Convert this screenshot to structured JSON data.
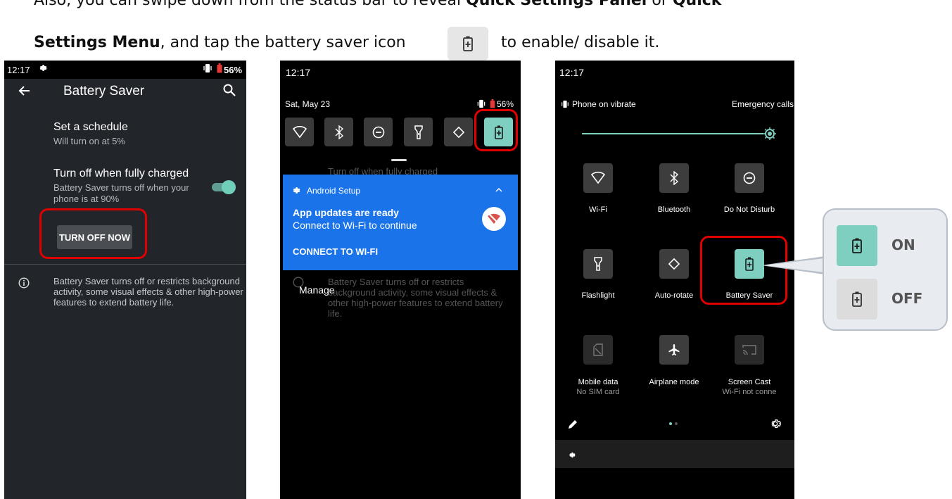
{
  "doc": {
    "line1_prefix": "Also, you can swipe down from the status bar to reveal ",
    "line1_bold1": "Quick Settings Panel",
    "line1_mid": " or ",
    "line1_bold2": "Quick",
    "line2_bold": "Settings Menu",
    "line2_mid": ", and tap the battery saver icon ",
    "line2_suffix": " to enable/ disable it."
  },
  "phone1": {
    "status_time": "12:17",
    "status_battery": "56%",
    "title": "Battery Saver",
    "schedule_title": "Set a schedule",
    "schedule_sub": "Will turn on at 5%",
    "charged_title": "Turn off when fully charged",
    "charged_sub_line1": "Battery Saver turns off when your",
    "charged_sub_line2": "phone is at 90%",
    "button": "TURN OFF NOW",
    "info": "Battery Saver turns off or restricts background activity, some visual effects & other high-power features to extend battery life."
  },
  "phone2": {
    "time": "12:17",
    "date": "Sat, May 23",
    "battery": "56%",
    "ghost_top": "Turn off when fully charged",
    "notif_app": "Android Setup",
    "notif_title": "App updates are ready",
    "notif_body": "Connect to Wi-Fi to continue",
    "notif_action": "CONNECT TO WI-FI",
    "manage": "Manage",
    "ghost_info": "Battery Saver turns off or restricts background activity, some visual effects & other high-power features to extend battery life."
  },
  "phone3": {
    "time": "12:17",
    "vibrate": "Phone on vibrate",
    "emergency": "Emergency calls",
    "tiles": {
      "wifi": "Wi-Fi",
      "bluetooth": "Bluetooth",
      "dnd": "Do Not Disturb",
      "flashlight": "Flashlight",
      "autorotate": "Auto-rotate",
      "battery_saver": "Battery Saver",
      "mobile_data": "Mobile data",
      "mobile_data_sub": "No SIM card",
      "airplane": "Airplane mode",
      "screen_cast": "Screen Cast",
      "screen_cast_sub": "Wi-Fi not conne"
    }
  },
  "callout": {
    "on_label": "ON",
    "off_label": "OFF"
  },
  "colors": {
    "accent": "#7ecfc0",
    "highlight": "#e00000",
    "notification": "#1a73e8"
  }
}
